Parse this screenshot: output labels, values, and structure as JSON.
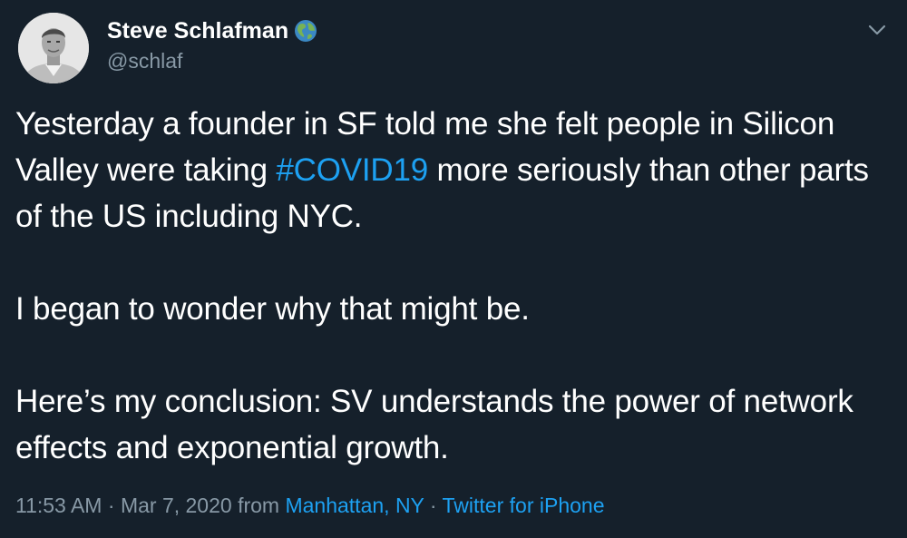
{
  "author": {
    "display_name": "Steve Schlafman",
    "name_badge_icon": "globe-americas-emoji-icon",
    "handle": "@schlaf"
  },
  "menu_icon": "chevron-down-icon",
  "tweet": {
    "line1_before": "Yesterday a founder in SF told me she felt people in Silicon Valley were taking ",
    "hashtag": "#COVID19",
    "line1_after": " more seriously than other parts of the US including NYC.",
    "paragraph2": "I began to wonder why that might be.",
    "paragraph3": "Here’s my conclusion: SV understands the power of network effects and exponential growth."
  },
  "meta": {
    "time": "11:53 AM",
    "sep1": " · ",
    "date": "Mar 7, 2020",
    "from_label": " from ",
    "location": "Manhattan, NY",
    "sep2": " · ",
    "source": "Twitter for iPhone"
  },
  "colors": {
    "background": "#15202b",
    "text": "#ffffff",
    "secondary": "#8899a6",
    "accent": "#1da1f2"
  }
}
